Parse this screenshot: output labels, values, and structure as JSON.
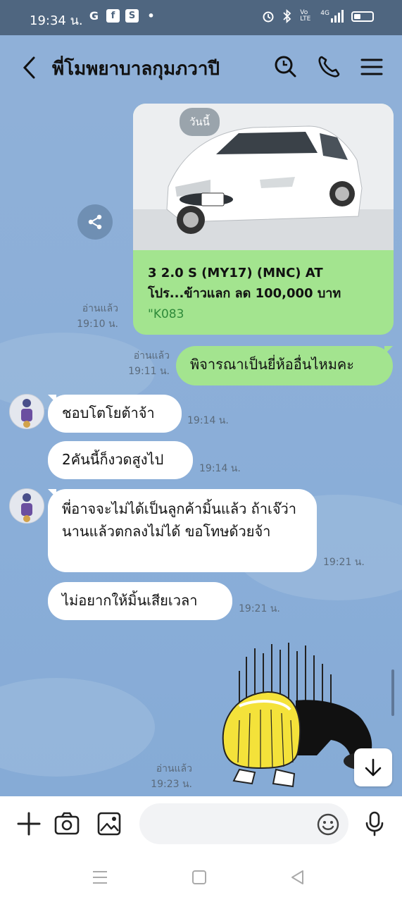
{
  "status_bar": {
    "time": "19:34 น.",
    "left_icons": [
      "google-icon",
      "facebook-icon",
      "s-app-icon",
      "dot-icon"
    ],
    "right_icons": [
      "alarm-icon",
      "bluetooth-icon",
      "volte-icon",
      "signal-4g-icon"
    ],
    "network_label": "4G",
    "volte_label": "Vo LTE"
  },
  "header": {
    "title": "พี่โมพยาบาลกุมภวาปี"
  },
  "messages": {
    "card": {
      "date_chip": "วันนี้",
      "headline": "3 2.0 S (MY17) (MNC) AT โปร...ข้าวแลก ลด 100,000 บาท",
      "code": "\"K083",
      "read": "อ่านแล้ว",
      "time": "19:10 น."
    },
    "out1": {
      "text": "พิจารณาเป็นยี่ห้ออื่นไหมคะ",
      "read": "อ่านแล้ว",
      "time": "19:11 น."
    },
    "in1": {
      "text": "ชอบโตโยต้าจ้า",
      "time": "19:14 น."
    },
    "in2": {
      "text": "2คันนี้ก็งวดสูงไป",
      "time": "19:14 น."
    },
    "in3": {
      "text": "พี่อาจจะไม่ได้เป็นลูกค้ามิ้นแล้ว ถ้าเจ๊ว่านานแล้วตกลงไม่ได้ ขอโทษด้วยจ้า",
      "time": "19:21 น."
    },
    "in4": {
      "text": "ไม่อยากให้มิ้นเสียเวลา",
      "time": "19:21 น."
    },
    "sticker": {
      "read": "อ่านแล้ว",
      "time": "19:23 น."
    }
  },
  "colors": {
    "chat_bg": "#8fb0d8",
    "status_bg": "#4f6680",
    "outgoing_bubble": "#a3e48f",
    "incoming_bubble": "#ffffff"
  }
}
